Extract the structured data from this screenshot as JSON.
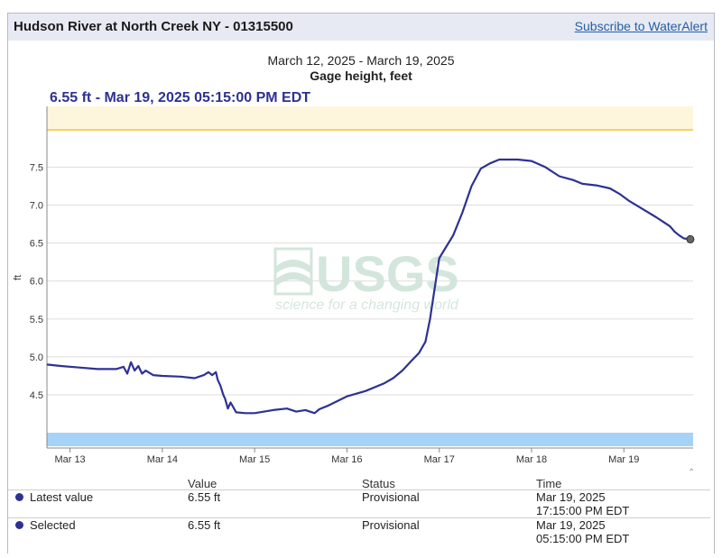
{
  "header": {
    "title": "Hudson River at North Creek NY - 01315500",
    "subscribe_label": "Subscribe to WaterAlert"
  },
  "chart_header": {
    "date_range": "March 12, 2025 - March 19, 2025",
    "parameter": "Gage height, feet",
    "readout": "6.55 ft - Mar 19, 2025 05:15:00 PM EDT"
  },
  "watermark": {
    "logo_text": "USGS",
    "tagline": "science for a changing world"
  },
  "colors": {
    "series": "#2e3192",
    "threshold_line": "#f2d15c",
    "threshold_band": "#fdf6dc",
    "lower_band": "#a6d2f7",
    "grid": "#dddddd"
  },
  "chart_data": {
    "type": "line",
    "title": "Gage height, feet",
    "subtitle": "March 12, 2025 - March 19, 2025",
    "ylabel": "ft",
    "xlabel": "",
    "ylim": [
      3.8,
      8.3
    ],
    "xlim": [
      12.75,
      19.75
    ],
    "y_ticks": [
      4.5,
      5.0,
      5.5,
      6.0,
      6.5,
      7.0,
      7.5
    ],
    "y_tick_labels": [
      "4.5",
      "5.0",
      "5.5",
      "6.0",
      "6.5",
      "7.0",
      "7.5"
    ],
    "x_ticks": [
      13,
      14,
      15,
      16,
      17,
      18,
      19
    ],
    "x_tick_labels": [
      "Mar 13",
      "Mar 14",
      "Mar 15",
      "Mar 16",
      "Mar 17",
      "Mar 18",
      "Mar 19"
    ],
    "threshold": 7.99,
    "grid": true,
    "legend": "none",
    "series": [
      {
        "x": [
          12.75,
          12.9,
          13.1,
          13.3,
          13.5,
          13.58,
          13.62,
          13.66,
          13.7,
          13.74,
          13.78,
          13.82,
          13.9,
          14.0,
          14.2,
          14.35,
          14.45,
          14.5,
          14.54,
          14.58,
          14.6,
          14.63,
          14.66,
          14.68,
          14.71,
          14.74,
          14.8,
          14.9,
          15.0,
          15.2,
          15.35,
          15.45,
          15.55,
          15.65,
          15.7,
          15.8,
          15.9,
          16.0,
          16.2,
          16.4,
          16.5,
          16.6,
          16.7,
          16.78,
          16.85,
          16.9,
          16.95,
          17.0,
          17.05,
          17.15,
          17.25,
          17.35,
          17.45,
          17.55,
          17.65,
          17.75,
          17.85,
          18.0,
          18.15,
          18.3,
          18.45,
          18.55,
          18.7,
          18.85,
          18.95,
          19.05,
          19.2,
          19.35,
          19.45,
          19.5,
          19.55,
          19.6,
          19.65,
          19.72
        ],
        "y": [
          4.9,
          4.88,
          4.86,
          4.84,
          4.84,
          4.87,
          4.78,
          4.93,
          4.82,
          4.88,
          4.78,
          4.82,
          4.76,
          4.75,
          4.74,
          4.72,
          4.76,
          4.8,
          4.76,
          4.8,
          4.7,
          4.62,
          4.5,
          4.45,
          4.32,
          4.4,
          4.27,
          4.26,
          4.26,
          4.3,
          4.32,
          4.28,
          4.3,
          4.26,
          4.31,
          4.36,
          4.42,
          4.48,
          4.55,
          4.65,
          4.72,
          4.82,
          4.95,
          5.05,
          5.2,
          5.5,
          5.9,
          6.3,
          6.4,
          6.6,
          6.9,
          7.25,
          7.48,
          7.55,
          7.6,
          7.6,
          7.6,
          7.58,
          7.5,
          7.38,
          7.33,
          7.28,
          7.26,
          7.22,
          7.15,
          7.06,
          6.95,
          6.84,
          6.76,
          6.72,
          6.65,
          6.6,
          6.56,
          6.55
        ]
      }
    ]
  },
  "table": {
    "headers": {
      "value": "Value",
      "status": "Status",
      "time": "Time"
    },
    "rows": [
      {
        "label": "Latest value",
        "value": "6.55 ft",
        "status": "Provisional",
        "time_line1": "Mar 19, 2025",
        "time_line2": "17:15:00 PM EDT"
      },
      {
        "label": "Selected",
        "value": "6.55 ft",
        "status": "Provisional",
        "time_line1": "Mar 19, 2025",
        "time_line2": "05:15:00 PM EDT"
      }
    ]
  }
}
